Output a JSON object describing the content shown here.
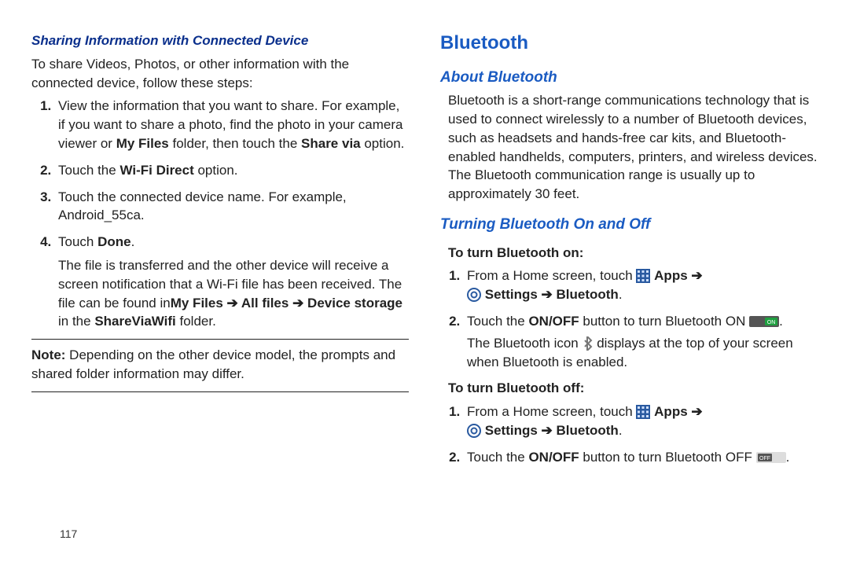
{
  "pageNumber": "117",
  "left": {
    "heading": "Sharing Information with Connected Device",
    "intro": "To share Videos, Photos, or other information with the connected device, follow these steps:",
    "step1_a": "View the information that you want to share. For example, if you want to share a photo, find the photo in your camera viewer or ",
    "step1_bold1": "My Files",
    "step1_b": " folder, then touch the ",
    "step1_bold2": "Share via",
    "step1_c": " option.",
    "step2_a": "Touch the ",
    "step2_bold": "Wi-Fi Direct",
    "step2_b": " option.",
    "step3": "Touch the connected device name. For example, Android_55ca.",
    "step4_a": "Touch ",
    "step4_bold": "Done",
    "step4_b": ".",
    "step4_detail_a": "The file is transferred and the other device will receive a screen notification that a Wi-Fi file has been received. The file can be found in",
    "step4_detail_bold1": "My Files",
    "step4_arrow": " ➔ ",
    "step4_detail_bold2": "All files",
    "step4_arrow2": " ➔ ",
    "step4_detail_bold3": "Device storage",
    "step4_detail_b": " in the ",
    "step4_detail_bold4": "ShareViaWifi",
    "step4_detail_c": " folder.",
    "note_label": "Note:",
    "note_text": " Depending on the other device model, the prompts and shared folder information may differ."
  },
  "right": {
    "h1": "Bluetooth",
    "h2a": "About Bluetooth",
    "about": "Bluetooth is a short-range communications technology that is used to connect wirelessly to a number of Bluetooth devices, such as headsets and hands-free car kits, and Bluetooth-enabled handhelds, computers, printers, and wireless devices. The Bluetooth communication range is usually up to approximately 30 feet.",
    "h2b": "Turning Bluetooth On and Off",
    "onHeading": "To turn Bluetooth on:",
    "on1_a": "From a Home screen, touch ",
    "apps_label": "Apps",
    "arrow": " ➔ ",
    "settings_label": "Settings",
    "bt_label": "Bluetooth",
    "period": ".",
    "on2_a": "Touch the ",
    "on2_bold": "ON/OFF",
    "on2_b": " button to turn Bluetooth ON ",
    "on_toggle": "ON",
    "on3_a": "The Bluetooth icon ",
    "on3_b": " displays at the top of your screen when Bluetooth is enabled.",
    "offHeading": "To turn Bluetooth off:",
    "off2_a": "Touch the ",
    "off2_bold": "ON/OFF",
    "off2_b": " button to turn Bluetooth OFF ",
    "off_toggle": "OFF"
  }
}
